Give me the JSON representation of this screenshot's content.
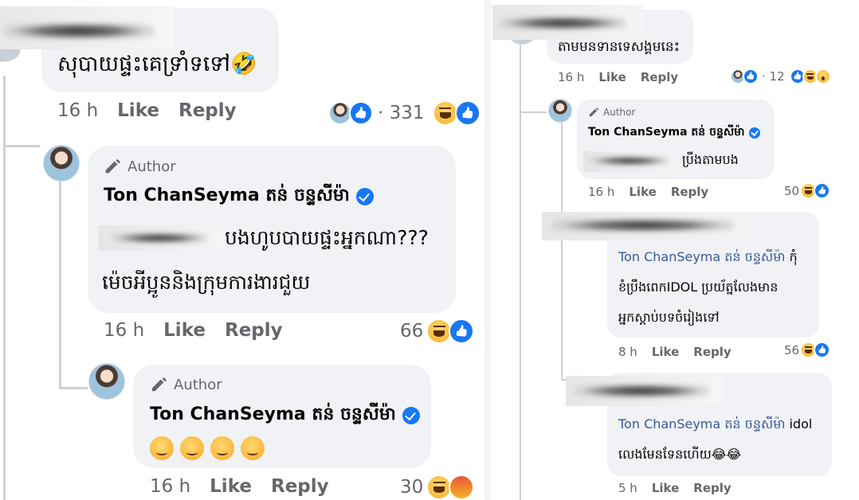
{
  "left": {
    "c1": {
      "text": "សុបាយផ្ទះគេទ្រាំទទៅ🤣",
      "time": "16 h",
      "like": "Like",
      "reply": "Reply",
      "count": "· 331"
    },
    "c2": {
      "author_tag": "Author",
      "name": "Ton  ChanSeyma តន់ ចន្ទសីម៉ា",
      "line1": "បងហូបបាយផ្ទះអ្នកណា???",
      "line2": "ម៉េចអីប្អូននិងក្រុមការងារជួយ",
      "time": "16 h",
      "like": "Like",
      "reply": "Reply",
      "count": "66"
    },
    "c3": {
      "author_tag": "Author",
      "name": "Ton  ChanSeyma តន់ ចន្ទសីម៉ា",
      "emojis": "😉😉😉😉",
      "time": "16 h",
      "like": "Like",
      "reply": "Reply",
      "count": "30"
    }
  },
  "right": {
    "r1": {
      "text": "តាមមនទានទេសង្គមនេះ",
      "time": "16 h",
      "like": "Like",
      "reply": "Reply",
      "count": "· 12"
    },
    "r2": {
      "author_tag": "Author",
      "name": "Ton ChanSeyma តន់ ចន្ទសីម៉ា",
      "text": "ប្រឹងតាមបង",
      "time": "16 h",
      "like": "Like",
      "reply": "Reply",
      "count": "50"
    },
    "r3": {
      "mention": "Ton  ChanSeyma តន់ ចន្ទសីម៉ា",
      "mention_tail": " កុំ",
      "line2": "ខំប្រឹងពេកIDOL ប្រយ័ត្នលែងមាន",
      "line3": "អ្នកស្តាប់បទចំរៀងទៅ",
      "time": "8 h",
      "like": "Like",
      "reply": "Reply",
      "count": "56"
    },
    "r4": {
      "mention": "Ton  ChanSeyma តន់ ចន្ទសីម៉ា",
      "mention_tail": " idol",
      "line2": "លេងមែនទែនហើយ😂😂",
      "time": "5 h",
      "like": "Like",
      "reply": "Reply"
    }
  },
  "colors": {
    "bubble": "#f0f2f5",
    "meta_text": "#65676b",
    "mention": "#385898",
    "verified": "#1877f2"
  },
  "icons": [
    "pencil-icon",
    "verified-badge-icon",
    "like-reaction-icon",
    "haha-reaction-icon",
    "angry-reaction-icon",
    "wow-reaction-icon",
    "wink-emoji"
  ]
}
